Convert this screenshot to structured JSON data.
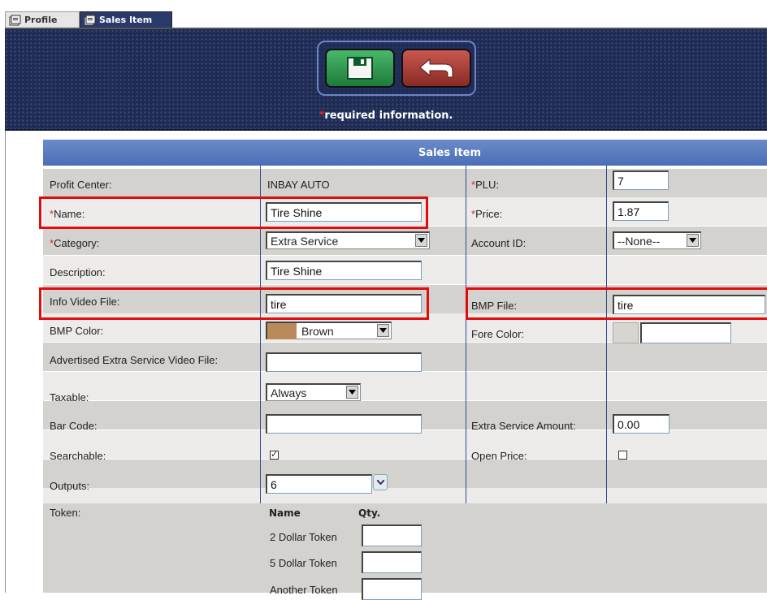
{
  "tabs": [
    {
      "label": "Profile"
    },
    {
      "label": "Sales Item"
    }
  ],
  "header": {
    "required_star": "*",
    "required_text": "required information."
  },
  "form": {
    "title": "Sales Item",
    "profit_center": {
      "label": "Profit Center:",
      "value": "INBAY AUTO"
    },
    "plu": {
      "star": "*",
      "label": "PLU:",
      "value": "7"
    },
    "name": {
      "star": "*",
      "label": "Name:",
      "value": "Tire Shine"
    },
    "price": {
      "star": "*",
      "label": "Price:",
      "value": "1.87"
    },
    "category": {
      "star": "*",
      "label": "Category:",
      "value": "Extra Service"
    },
    "account_id": {
      "label": "Account ID:",
      "value": "--None--"
    },
    "description": {
      "label": "Description:",
      "value": "Tire Shine"
    },
    "info_video": {
      "label": "Info Video File:",
      "value": "tire"
    },
    "bmp_file": {
      "label": "BMP File:",
      "value": "tire"
    },
    "bmp_color": {
      "label": "BMP Color:",
      "value": "Brown",
      "swatch": "#b98a5a"
    },
    "fore_color": {
      "label": "Fore Color:",
      "value": "",
      "swatch": "#d8d4d0"
    },
    "adv_video": {
      "label": "Advertised Extra Service Video File:",
      "value": ""
    },
    "taxable": {
      "label": "Taxable:",
      "value": "Always"
    },
    "bar_code": {
      "label": "Bar Code:",
      "value": ""
    },
    "extra_amount": {
      "label": "Extra Service Amount:",
      "value": "0.00"
    },
    "searchable": {
      "label": "Searchable:",
      "checked": true
    },
    "open_price": {
      "label": "Open Price:",
      "checked": false
    },
    "outputs": {
      "label": "Outputs:",
      "value": "6"
    },
    "token": {
      "label": "Token:",
      "col_name": "Name",
      "col_qty": "Qty.",
      "items": [
        {
          "name": "2 Dollar Token",
          "qty": ""
        },
        {
          "name": "5 Dollar Token",
          "qty": ""
        },
        {
          "name": "Another Token",
          "qty": ""
        }
      ]
    }
  },
  "colors": {
    "highlight": "#e10d0d",
    "header_bg": "#1f2b52",
    "title_bar": "#5a7cc0"
  }
}
